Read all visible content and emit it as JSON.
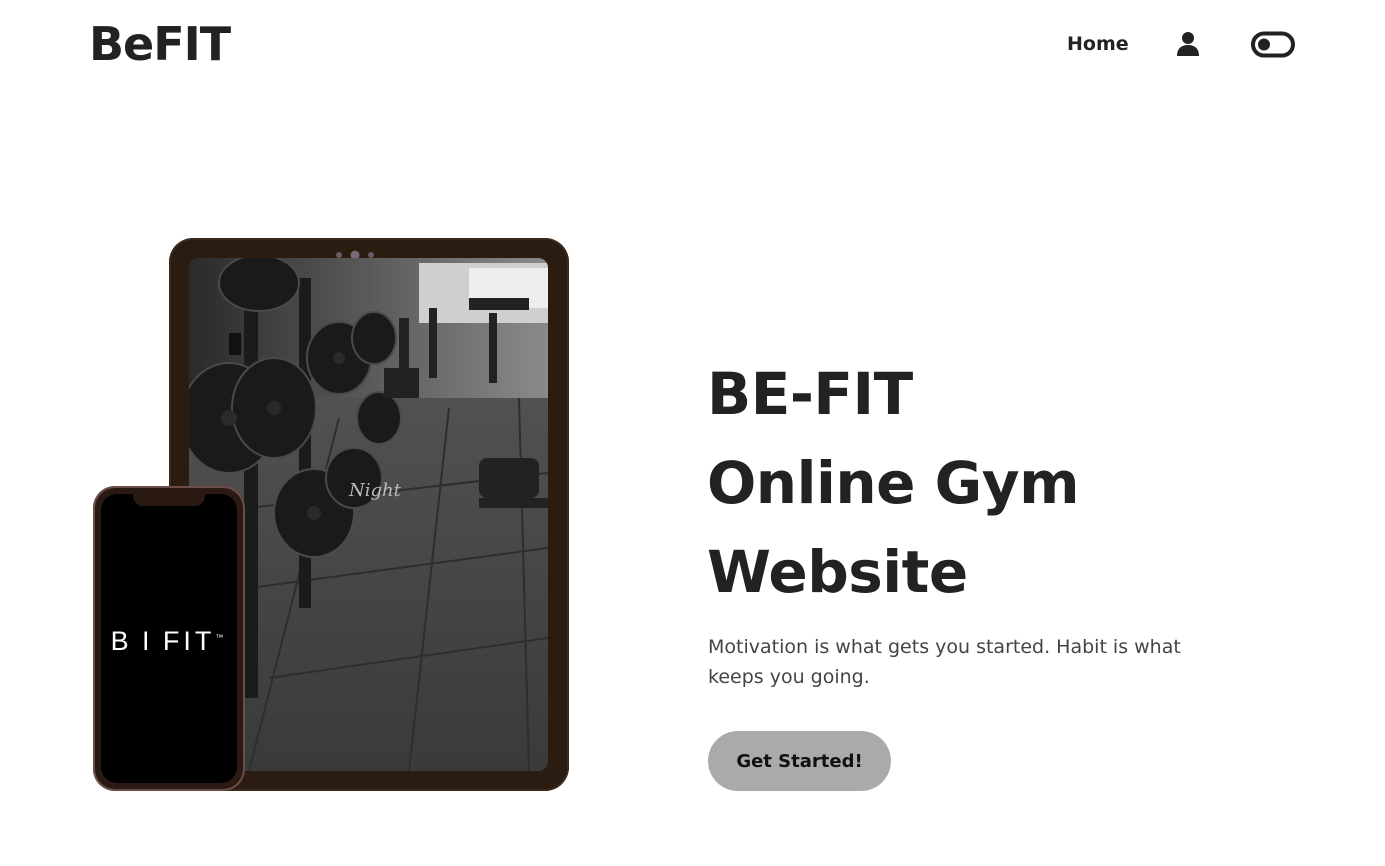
{
  "header": {
    "logo": "BeFIT",
    "nav": {
      "home_label": "Home"
    },
    "icons": {
      "user": "user-icon",
      "theme_toggle": "toggle-icon"
    }
  },
  "hero": {
    "title_lines": [
      "BE-FIT",
      "Online Gym",
      "Website"
    ],
    "tagline": "Motivation is what gets you started. Habit is what keeps you going.",
    "cta_label": "Get Started!"
  },
  "illustration": {
    "phone_brand": "B I FIT",
    "phone_brand_tm": "™",
    "tablet_overlay_text": "Night"
  },
  "colors": {
    "text": "#222222",
    "tagline": "#444444",
    "cta_background": "#aaaaaa",
    "device_frame": "#2a1c10",
    "phone_screen": "#000000"
  }
}
